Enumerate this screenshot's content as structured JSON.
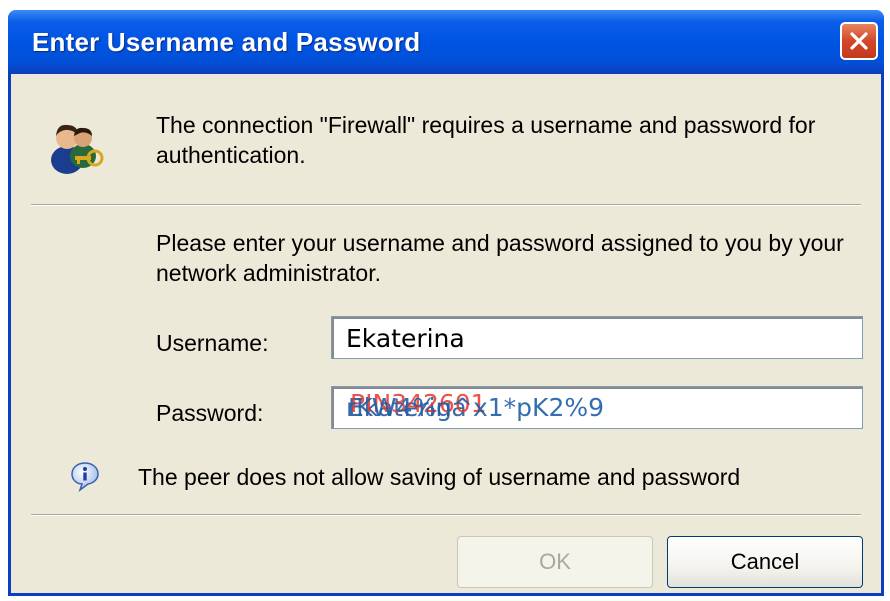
{
  "dialog": {
    "title": "Enter Username and Password",
    "close_icon": "close-icon",
    "message": "The connection \"Firewall\" requires a username and password for authentication.",
    "instruction": "Please enter your username and password assigned to you by your network administrator.",
    "username": {
      "label": "Username:",
      "value": "Ekaterina"
    },
    "password": {
      "label": "Password:",
      "overlapping_values": [
        "Ekaterina",
        "PIN342601",
        "rKW4%g^x1*pK2%9"
      ]
    },
    "info_message": "The peer does not allow saving of username and password",
    "buttons": {
      "ok": {
        "label": "OK",
        "enabled": false
      },
      "cancel": {
        "label": "Cancel",
        "enabled": true
      }
    }
  },
  "colors": {
    "titlebar": "#0054e3",
    "window_bg": "#ece9d8",
    "close_button": "#d2472a",
    "password_overlay_red": "#e8352b",
    "password_overlay_blue": "#1f5fa8"
  }
}
